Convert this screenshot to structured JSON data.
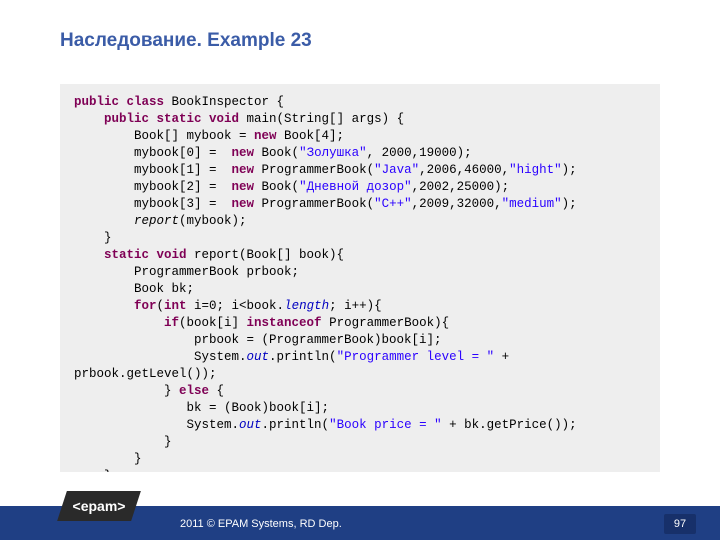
{
  "title": "Наследование. Example 23",
  "footer": {
    "badge": "<epam>",
    "text": "2011 © EPAM Systems, RD Dep.",
    "page": "97"
  },
  "code": {
    "class_decl": {
      "kw1": "public class",
      "name": " BookInspector {"
    },
    "main_decl": {
      "kw1": "public static void",
      "name": " main(String[] args) {"
    },
    "line_arr": {
      "pre": "        Book[] mybook = ",
      "kw": "new",
      "post": " Book[4];"
    },
    "line0": {
      "pre": "        mybook[0] =  ",
      "kw": "new",
      "mid": " Book(",
      "s": "\"Золушка\"",
      "post": ", 2000,19000);"
    },
    "line1": {
      "pre": "        mybook[1] =  ",
      "kw": "new",
      "mid": " ProgrammerBook(",
      "s1": "\"Java\"",
      "c": ",2006,46000,",
      "s2": "\"hight\"",
      "post": ");"
    },
    "line2": {
      "pre": "        mybook[2] =  ",
      "kw": "new",
      "mid": " Book(",
      "s": "\"Дневной дозор\"",
      "post": ",2002,25000);"
    },
    "line3": {
      "pre": "        mybook[3] =  ",
      "kw": "new",
      "mid": " ProgrammerBook(",
      "s1": "\"C++\"",
      "c": ",2009,32000,",
      "s2": "\"medium\"",
      "post": ");"
    },
    "line_rep_call": {
      "fn": "        report",
      "post": "(mybook);"
    },
    "brace_main_close": "    }",
    "report_decl": {
      "kw": "    static void",
      "name": " report(Book[] book){"
    },
    "line_prbook": "        ProgrammerBook prbook;",
    "line_bk": "        Book bk;",
    "for_line": {
      "kw1": "        for",
      "p1": "(",
      "kw2": "int",
      "p2": " i=0; i<book.",
      "fld": "length",
      "p3": "; i++){"
    },
    "if_line": {
      "kw1": "            if",
      "p1": "(book[i] ",
      "kw2": "instanceof",
      "p2": " ProgrammerBook){"
    },
    "line_cast1": "                prbook = (ProgrammerBook)book[i];",
    "println1": {
      "p1": "                System.",
      "fld": "out",
      "p2": ".println(",
      "s": "\"Programmer level = \"",
      "p3": " + "
    },
    "println1_cont": "prbook.getLevel());",
    "else_line": {
      "p1": "            } ",
      "kw": "else",
      "p2": " {"
    },
    "line_cast2": "               bk = (Book)book[i];",
    "println2": {
      "p1": "               System.",
      "fld": "out",
      "p2": ".println(",
      "s": "\"Book price = \"",
      "p3": " + bk.getPrice());"
    },
    "brace_if_close": "            }",
    "brace_for_close": "        }",
    "brace_report_close": "    }",
    "brace_class_close": "}"
  }
}
